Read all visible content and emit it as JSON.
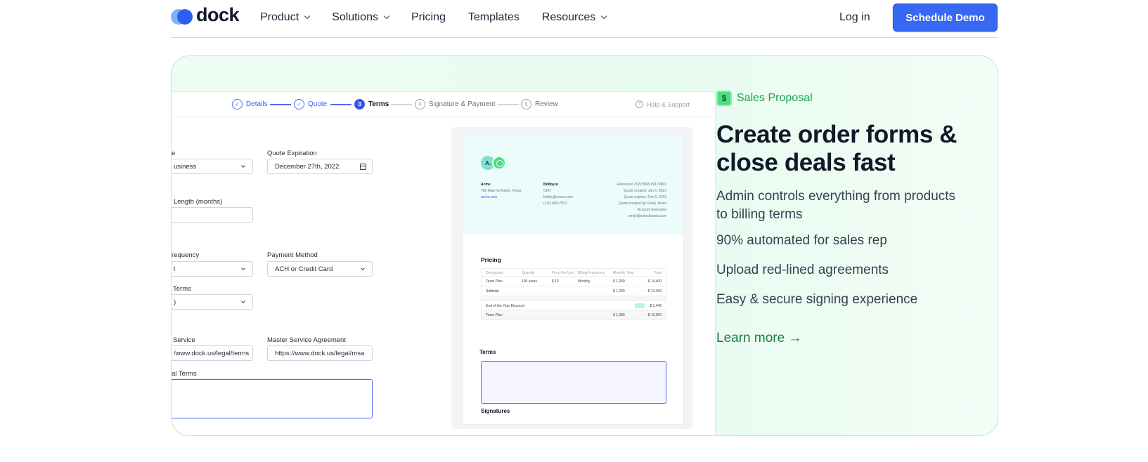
{
  "nav": {
    "logo_text": "dock",
    "items": [
      {
        "label": "Product",
        "dropdown": true
      },
      {
        "label": "Solutions",
        "dropdown": true
      },
      {
        "label": "Pricing",
        "dropdown": false
      },
      {
        "label": "Templates",
        "dropdown": false
      },
      {
        "label": "Resources",
        "dropdown": true
      }
    ],
    "login": "Log in",
    "cta": "Schedule Demo"
  },
  "preview": {
    "steps": [
      {
        "num": "",
        "label": "Details",
        "state": "done"
      },
      {
        "num": "",
        "label": "Quote",
        "state": "done"
      },
      {
        "num": "3",
        "label": "Terms",
        "state": "current"
      },
      {
        "num": "4",
        "label": "Signature & Payment",
        "state": "todo"
      },
      {
        "num": "5",
        "label": "Review",
        "state": "todo"
      }
    ],
    "help": "Help & Support",
    "form": {
      "business_label": "e",
      "business_value": "usiness",
      "quote_exp_label": "Quote Expiration",
      "quote_exp_value": "December 27th, 2022",
      "length_label": "Length (months)",
      "freq_label": "requency",
      "freq_value": "l",
      "payment_method_label": "Payment Method",
      "payment_method_value": "ACH or Credit Card",
      "terms_label": "Terms",
      "terms_value": ")",
      "service_label": "Service",
      "service_value": "/www.dock.us/legal/terms",
      "msa_label": "Master Service Agreement",
      "msa_value": "https://www.dock.us/legal/msa",
      "additional_label": "al Terms"
    },
    "doc": {
      "avatar_initials": "A.",
      "company": {
        "name": "Acme",
        "address": "766 Main St Austin, Texas",
        "url": "acme.com"
      },
      "contact": {
        "name": "Bobby.io",
        "title": "CFO",
        "email": "bobby@acme.com",
        "phone": "(111) 869-7021"
      },
      "meta": [
        "Reference 20220908-09170863",
        "Quote created: Jan 6, 2023",
        "Quote expires: Feb 6, 2023",
        "Quote created by: Emily Jones",
        "Account Executive",
        "emily@ir.dockdeals.com"
      ],
      "pricing_title": "Pricing",
      "table_headers": [
        "Description",
        "Quantity",
        "Price Per Unit",
        "Billing Frequency",
        "Monthly Total",
        "Total"
      ],
      "rows": [
        {
          "description": "Team Plan",
          "quantity": "100 users",
          "price": "$ 12",
          "frequency": "Monthly",
          "monthly": "$ 1,200",
          "total": "$ 14,400"
        },
        {
          "description": "Subtotal",
          "quantity": "",
          "price": "",
          "frequency": "",
          "monthly": "$ 1,200",
          "total": "$ 14,400"
        },
        {
          "description": "End of the Year Discount",
          "quantity": "",
          "price": "",
          "frequency": "",
          "monthly": "",
          "total": "$ 1,440"
        },
        {
          "description": "Team Plan",
          "quantity": "",
          "price": "",
          "frequency": "",
          "monthly": "$ 1,080",
          "total": "$ 12,960"
        }
      ],
      "terms_title": "Terms",
      "signatures_title": "Signatures"
    }
  },
  "feature": {
    "badge": "Sales Proposal",
    "headline": "Create order forms & close deals fast",
    "bullets": [
      "Admin controls everything from products to billing terms",
      "90% automated for sales rep",
      "Upload red-lined agreements",
      "Easy & secure signing experience"
    ],
    "cta": "Learn more →"
  },
  "colors": {
    "accent": "#3668f2",
    "green": "#16a34a",
    "card_bg": "#eefdf4"
  }
}
